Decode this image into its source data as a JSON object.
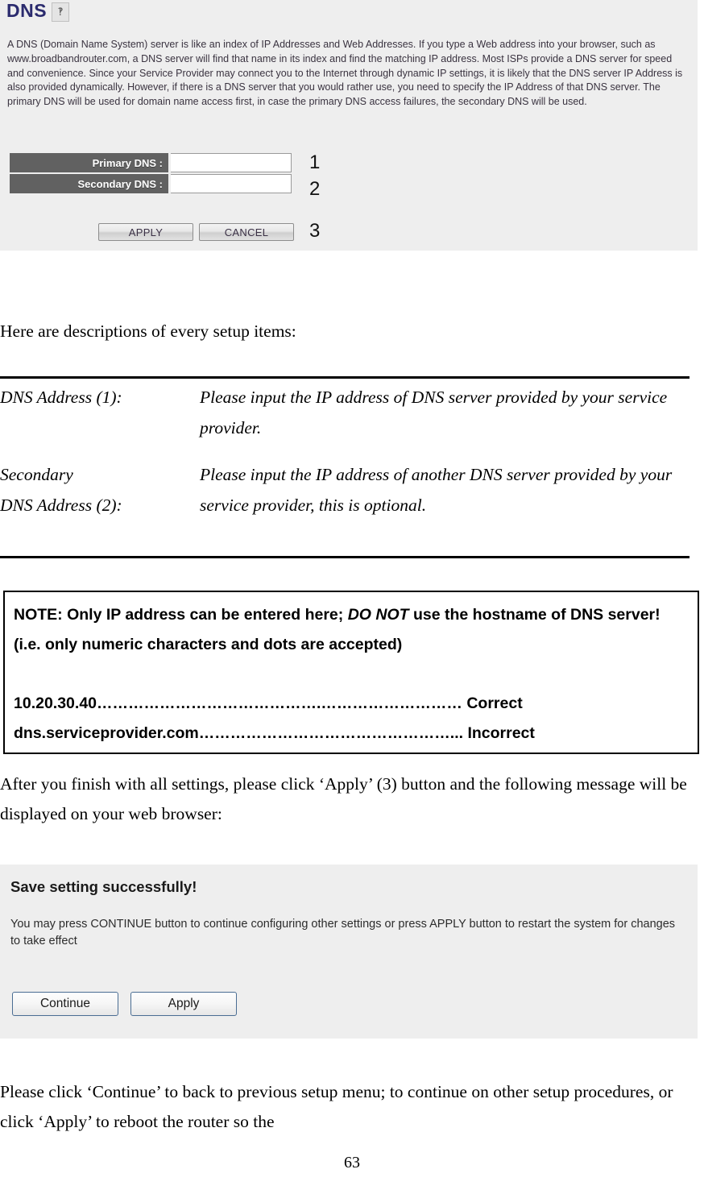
{
  "router_panel": {
    "title": "DNS",
    "icon": "broken-image-icon",
    "description": "A DNS (Domain Name System) server is like an index of IP Addresses and Web Addresses. If you type a Web address into your browser, such as www.broadbandrouter.com, a DNS server will find that name in its index and find the matching IP address. Most ISPs provide a DNS server for speed and convenience. Since your Service Provider may connect you to the Internet through dynamic IP settings, it is likely that the DNS server IP Address is also provided dynamically. However, if there is a DNS server that you would rather use, you need to specify the IP Address of that DNS server. The primary DNS will be used for domain name access first, in case the primary DNS access failures, the secondary DNS will be used.",
    "fields": [
      {
        "label": "Primary DNS :",
        "value": "",
        "placeholder": ""
      },
      {
        "label": "Secondary DNS :",
        "value": "",
        "placeholder": ""
      }
    ],
    "buttons": {
      "apply": "APPLY",
      "cancel": "CANCEL"
    },
    "callouts": {
      "one": "1",
      "two": "2",
      "three": "3"
    },
    "colors": {
      "panel_background": "#eeeeee",
      "label_cell": "#616161",
      "title_text": "#2b2b6e"
    }
  },
  "document": {
    "intro_line": "Here are descriptions of every setup items:",
    "definitions": [
      {
        "term": "DNS Address (1):",
        "description": "Please input the IP address of DNS server provided by your service provider."
      },
      {
        "term_line_1": "Secondary",
        "term_line_2": "DNS Address (2):",
        "description": "Please input the IP address of another DNS server provided by your service provider, this is optional."
      }
    ],
    "note_box": {
      "line_1_pre": "NOTE: Only IP address can be entered here; ",
      "line_1_emphasis": "DO NOT",
      "line_1_post": " use the hostname of DNS server! (i.e. only numeric characters and dots are accepted)",
      "example_correct": "10.20.30.40…………………………………….……………………… Correct",
      "example_incorrect": "dns.serviceprovider.com…………………………………………... Incorrect"
    },
    "after_paragraph": "After you finish with all settings, please click ‘Apply’ (3) button and the following message will be displayed on your web browser:",
    "closing_paragraph": "Please click ‘Continue’ to back to previous setup menu; to continue on other setup procedures, or click ‘Apply’ to reboot the router so the",
    "page_number": "63"
  },
  "save_panel": {
    "title": "Save setting successfully!",
    "description": "You may press CONTINUE button to continue configuring other settings or press APPLY button to restart the system for changes to take effect",
    "buttons": {
      "continue": "Continue",
      "apply": "Apply"
    },
    "colors": {
      "panel_background": "#eeeeee",
      "button_border": "#4a6d93"
    }
  }
}
